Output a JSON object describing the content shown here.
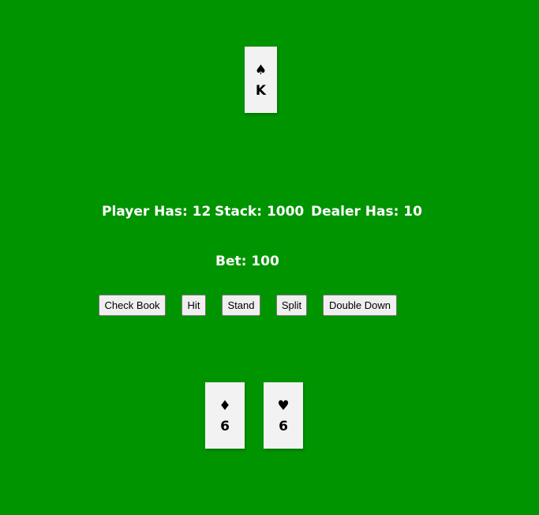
{
  "dealer": {
    "cards": [
      {
        "suit": "♠",
        "rank": "K"
      }
    ]
  },
  "status": {
    "player": "Player Has: 12",
    "stack": "Stack: 1000",
    "dealer": "Dealer Has: 10",
    "bet": "Bet: 100"
  },
  "buttons": {
    "check_book": "Check Book",
    "hit": "Hit",
    "stand": "Stand",
    "split": "Split",
    "double_down": "Double Down"
  },
  "player": {
    "cards": [
      {
        "suit": "♦",
        "rank": "6"
      },
      {
        "suit": "♥",
        "rank": "6"
      }
    ]
  },
  "colors": {
    "table": "#009400",
    "card": "#f2f2f2",
    "text": "#ffffff"
  }
}
